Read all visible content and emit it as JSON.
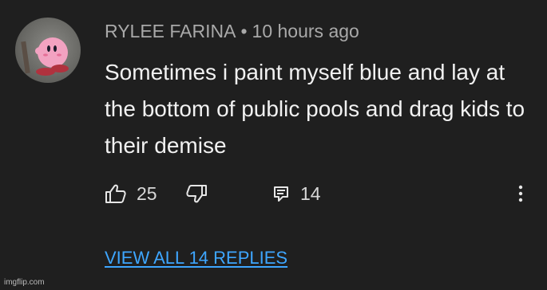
{
  "comment": {
    "author": "RYLEE FARINA",
    "separator": "•",
    "timestamp": "10 hours ago",
    "text": "Sometimes i paint myself blue and lay at the bottom of public pools and drag kids to their demise",
    "likes": "25",
    "replies_count": "14",
    "view_replies_label": "VIEW ALL 14 REPLIES",
    "avatar": "pink-character-avatar"
  },
  "icons": {
    "like": "thumbs-up-icon",
    "dislike": "thumbs-down-icon",
    "reply": "reply-icon",
    "more": "more-vert-icon"
  },
  "colors": {
    "background": "#1f1f1f",
    "author": "#a9a9a9",
    "text": "#f1f1f1",
    "link": "#3ea6ff"
  },
  "watermark": "imgflip.com"
}
